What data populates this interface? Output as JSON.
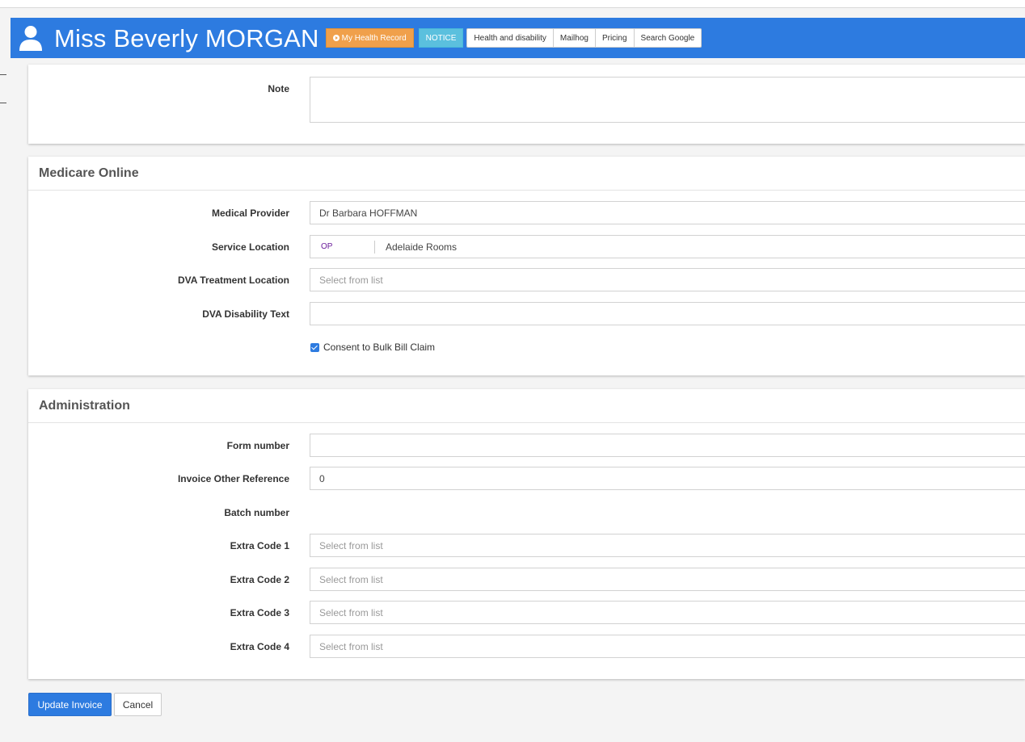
{
  "header": {
    "patient_name": "Miss Beverly MORGAN",
    "my_health_record_label": "My Health Record",
    "notice_label": "NOTICE",
    "links": [
      "Health and disability",
      "Mailhog",
      "Pricing",
      "Search Google"
    ],
    "colors": {
      "bar": "#2d7be0",
      "mhr": "#f0a04b",
      "notice": "#5bc0de"
    }
  },
  "note_section": {
    "note_label": "Note",
    "note_value": ""
  },
  "medicare": {
    "title": "Medicare Online",
    "medical_provider_label": "Medical Provider",
    "medical_provider_value": "Dr Barbara HOFFMAN",
    "service_location_label": "Service Location",
    "service_location_code": "OP",
    "service_location_value": "Adelaide Rooms",
    "dva_treatment_label": "DVA Treatment Location",
    "dva_treatment_placeholder": "Select from list",
    "dva_disability_label": "DVA Disability Text",
    "dva_disability_value": "",
    "consent_label": "Consent to Bulk Bill Claim",
    "consent_checked": true
  },
  "administration": {
    "title": "Administration",
    "form_number_label": "Form number",
    "form_number_value": "",
    "invoice_ref_label": "Invoice Other Reference",
    "invoice_ref_value": "0",
    "batch_number_label": "Batch number",
    "extra_codes": [
      {
        "label": "Extra Code 1",
        "placeholder": "Select from list"
      },
      {
        "label": "Extra Code 2",
        "placeholder": "Select from list"
      },
      {
        "label": "Extra Code 3",
        "placeholder": "Select from list"
      },
      {
        "label": "Extra Code 4",
        "placeholder": "Select from list"
      }
    ]
  },
  "actions": {
    "update_label": "Update Invoice",
    "cancel_label": "Cancel"
  }
}
